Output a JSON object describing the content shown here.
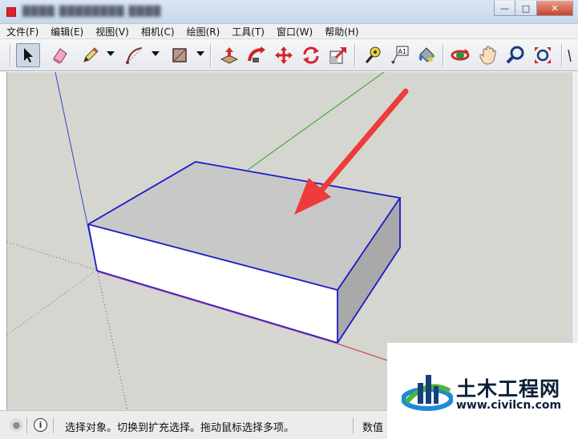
{
  "menu": {
    "items": [
      "文件(F)",
      "编辑(E)",
      "视图(V)",
      "相机(C)",
      "绘图(R)",
      "工具(T)",
      "窗口(W)",
      "帮助(H)"
    ]
  },
  "toolbar": {
    "tools": [
      "select-arrow-icon",
      "eraser-icon",
      "pencil-icon",
      "arc-icon",
      "rectangle-icon",
      "push-pull-icon",
      "follow-me-icon",
      "move-icon",
      "rotate-icon",
      "scale-icon",
      "tape-measure-icon",
      "text-label-icon",
      "paint-bucket-icon",
      "orbit-icon",
      "pan-hand-icon",
      "zoom-icon",
      "zoom-extents-icon"
    ],
    "text_tool_glyph": "A1"
  },
  "window": {
    "buttons": [
      "minimize",
      "maximize",
      "close"
    ]
  },
  "statusbar": {
    "hint": "选择对象。切换到扩充选择。拖动鼠标选择多项。",
    "value_label": "数值"
  },
  "colors": {
    "viewport": "#d5d6d0",
    "edge": "#1a1ac8",
    "arrow": "#ee3b3b",
    "red_axis": "#cc3333",
    "green_axis": "#2aa12a",
    "blue_axis": "#3344cc"
  },
  "watermark": {
    "brand": "土木工程网",
    "url": "www.civilcn.com"
  }
}
